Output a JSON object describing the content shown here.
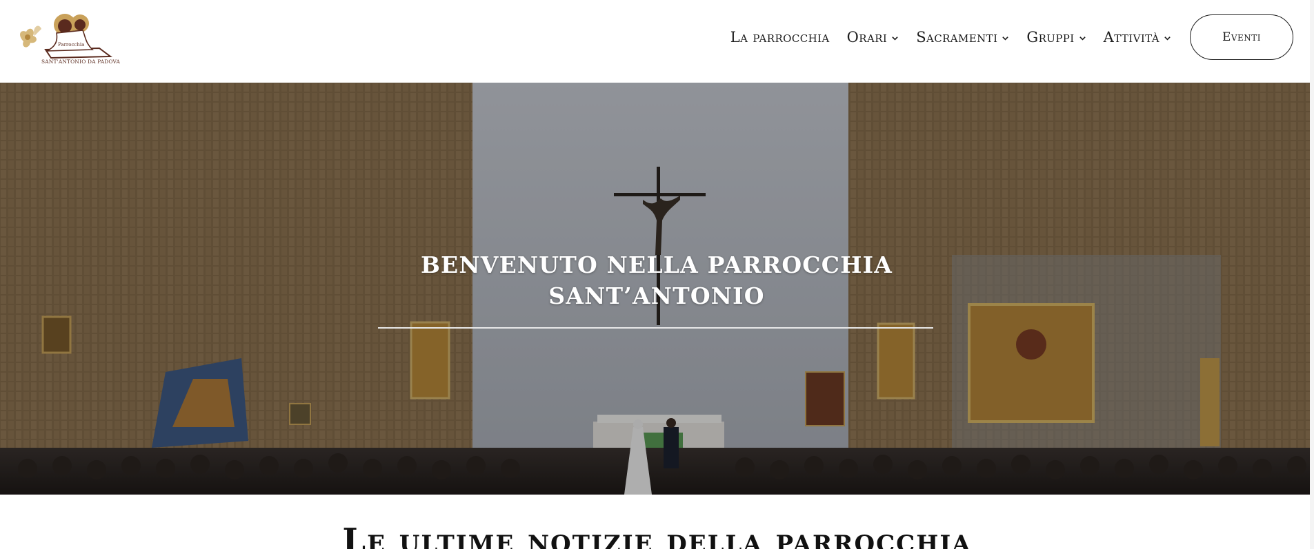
{
  "header": {
    "logo": {
      "text_line1": "Parrocchia",
      "text_line2": "Sant'Antonio da Padova"
    },
    "nav": [
      {
        "label": "La parrocchia",
        "has_dropdown": false
      },
      {
        "label": "Orari",
        "has_dropdown": true
      },
      {
        "label": "Sacramenti",
        "has_dropdown": true
      },
      {
        "label": "Gruppi",
        "has_dropdown": true
      },
      {
        "label": "Attività",
        "has_dropdown": true
      }
    ],
    "cta_label": "Eventi"
  },
  "hero": {
    "title_line1": "BENVENUTO NELLA PARROCCHIA",
    "title_line2": "SANT’ANTONIO"
  },
  "news": {
    "heading": "Le ultime notizie della parrocchia"
  },
  "colors": {
    "logo_brown": "#5a2a1e",
    "logo_gold": "#c9a15a",
    "wall": "#8a7150",
    "sky": "#b8bcc4"
  }
}
